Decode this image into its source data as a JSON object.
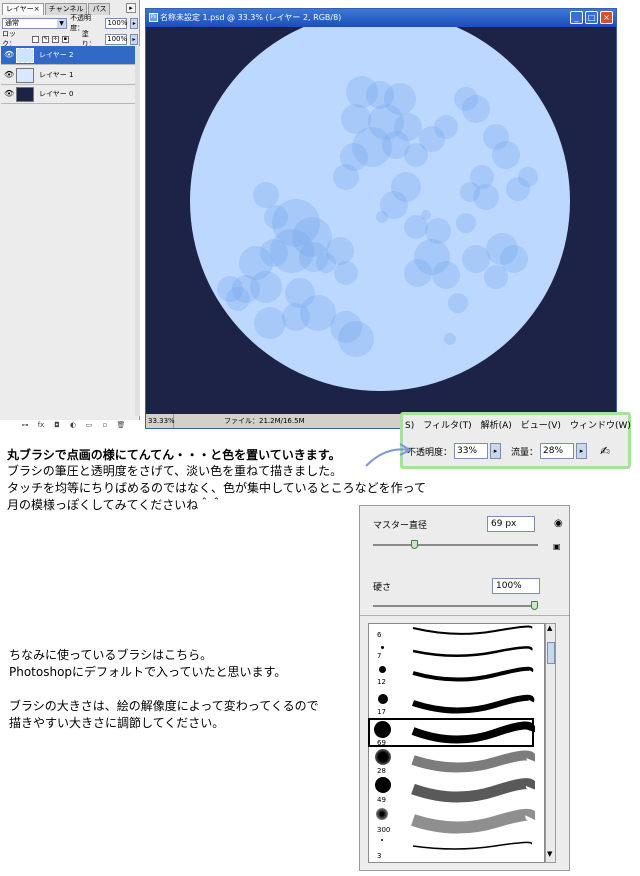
{
  "layers_panel": {
    "tabs": [
      "レイヤー×",
      "チャンネル",
      "パス"
    ],
    "blend_mode": "通常",
    "opacity_label": "不透明度：",
    "opacity_value": "100%",
    "lock_label": "ロック：",
    "fill_label": "塗り：",
    "fill_value": "100%",
    "layers": [
      {
        "name": "レイヤー 2",
        "selected": true,
        "thumb": "#cfe2ff"
      },
      {
        "name": "レイヤー 1",
        "selected": false,
        "thumb": "#d8e8ff"
      },
      {
        "name": "レイヤー 0",
        "selected": false,
        "thumb": "#1c2347"
      }
    ]
  },
  "document": {
    "title": "名称未設定 1.psd @ 33.3% (レイヤー 2, RGB/8)",
    "zoom": "33.33%",
    "file_info": "ファイル：21.2M/16.5M",
    "canvas_color": "#1c2347",
    "moon_color": "#bcd8ff",
    "spot_color": "#6fa1ea"
  },
  "options_bar": {
    "menus": [
      "S)",
      "フィルタ(T)",
      "解析(A)",
      "ビュー(V)",
      "ウィンドウ(W)"
    ],
    "opacity_label": "不透明度：",
    "opacity_value": "33%",
    "flow_label": "流量：",
    "flow_value": "28%"
  },
  "notes": {
    "line1": "丸ブラシで点画の様にてんてん・・・と色を置いていきます。",
    "line2": "ブラシの筆圧と透明度をさげて、淡い色を重ねて描きました。",
    "line3": "タッチを均等にちりばめるのではなく、色が集中しているところなどを作って",
    "line4": "月の模様っぽくしてみてくださいね＾＾",
    "line5": "ちなみに使っているブラシはこちら。",
    "line6": "Photoshopにデフォルトで入っていたと思います。",
    "line7": "ブラシの大きさは、絵の解像度によって変わってくるので",
    "line8": "描きやすい大きさに調節してください。"
  },
  "brush_panel": {
    "master_diameter_label": "マスター直径",
    "master_diameter_value": "69 px",
    "hardness_label": "硬さ",
    "hardness_value": "100%",
    "master_diameter_level": 0.25,
    "hardness_level": 1.0,
    "brushes": [
      {
        "size": "6"
      },
      {
        "size": "7"
      },
      {
        "size": "12"
      },
      {
        "size": "17"
      },
      {
        "size": "69",
        "selected": true
      },
      {
        "size": "28"
      },
      {
        "size": "49"
      },
      {
        "size": "300"
      },
      {
        "size": "3"
      }
    ]
  }
}
